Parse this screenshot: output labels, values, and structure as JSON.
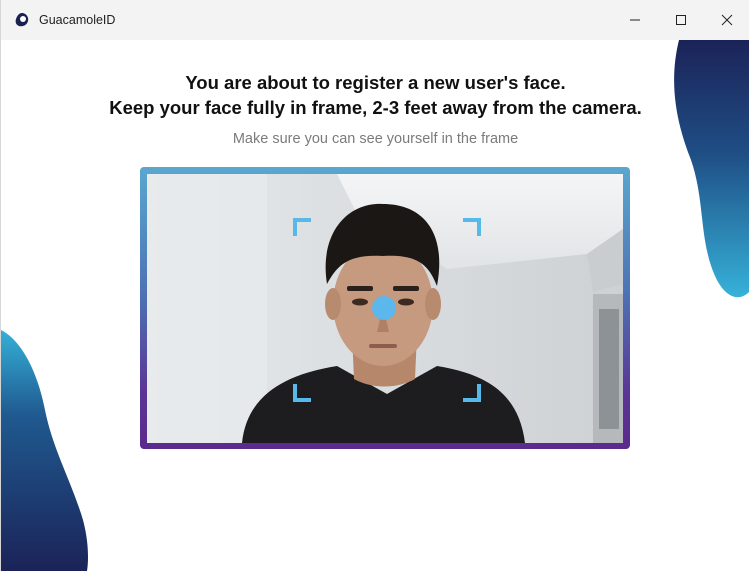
{
  "window": {
    "title": "GuacamoleID",
    "controls": {
      "minimize_icon": "minimize-icon",
      "maximize_icon": "maximize-icon",
      "close_icon": "close-icon"
    }
  },
  "main": {
    "heading_line1": "You are about to register a new user's face.",
    "heading_line2": "Keep your face fully in frame, 2-3 feet away from the camera.",
    "subtext": "Make sure you can see yourself in the frame"
  },
  "camera": {
    "feed": "live-camera-feed",
    "target_indicator": "face-target-dot",
    "frame_corners": "face-alignment-corners"
  },
  "colors": {
    "accent_blue": "#57b9ea",
    "frame_gradient_top": "#5aa7cf",
    "frame_gradient_bottom": "#5b2a8c",
    "blob_dark": "#1b2358",
    "blob_light": "#2fa3cf"
  }
}
